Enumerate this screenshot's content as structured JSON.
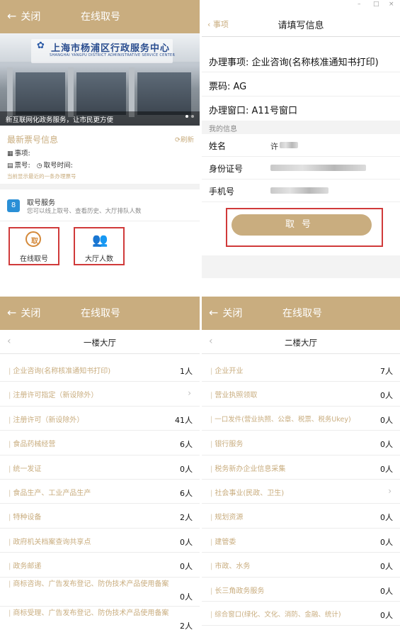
{
  "top_bar": {
    "close_label": "关闭",
    "title": "在线取号"
  },
  "panel1": {
    "banner": {
      "sign_cn": "上海市杨浦区行政服务中心",
      "sign_en": "SHANGHAI YANGPU DISTRICT ADMINISTRATIVE SERVICE CENTER",
      "caption": "新互联网化政务服务，让市民更方便"
    },
    "ticket": {
      "heading": "最新票号信息",
      "refresh": "刷新",
      "item_label": "事项:",
      "number_label": "票号:",
      "time_label": "取号时间:",
      "note": "当前显示最近的一条办理票号"
    },
    "service": {
      "title": "取号服务",
      "desc": "您可以线上取号、查看历史、大厅排队人数"
    },
    "tiles": [
      {
        "label": "在线取号",
        "icon_text": "取"
      },
      {
        "label": "大厅人数"
      }
    ]
  },
  "panel2": {
    "back_label": "事项",
    "title": "请填写信息",
    "matter": "办理事项: 企业咨询(名称核准通知书打印)",
    "ticket": "票码: AG",
    "window": "办理窗口: A11号窗口",
    "section": "我的信息",
    "fields": [
      {
        "label": "姓名",
        "value": "许"
      },
      {
        "label": "身份证号",
        "value": ""
      },
      {
        "label": "手机号",
        "value": ""
      }
    ],
    "submit_label": "取号"
  },
  "panel3": {
    "subtitle": "一楼大厅",
    "items": [
      {
        "name": "企业咨询(名称核准通知书打印)",
        "count": "1人"
      },
      {
        "name": "注册许可指定（新设除外）",
        "count": ""
      },
      {
        "name": "注册许可（新设除外）",
        "count": "41人"
      },
      {
        "name": "食品药械经营",
        "count": "6人"
      },
      {
        "name": "统一发证",
        "count": "0人"
      },
      {
        "name": "食品生产、工业产品生产",
        "count": "6人"
      },
      {
        "name": "特种设备",
        "count": "2人"
      },
      {
        "name": "政府机关档案查询共享点",
        "count": "0人"
      },
      {
        "name": "政务邮递",
        "count": "0人"
      },
      {
        "name": "商标咨询、广告发布登记、防伪技术产品使用备案",
        "count": "0人"
      },
      {
        "name": "商标受理、广告发布登记、防伪技术产品使用备案",
        "count": "2人"
      }
    ]
  },
  "panel4": {
    "subtitle": "二楼大厅",
    "items": [
      {
        "name": "企业开业",
        "count": "7人"
      },
      {
        "name": "营业执照领取",
        "count": "0人"
      },
      {
        "name": "一口发件(营业执照、公章、税票、税务Ukey)",
        "count": "0人"
      },
      {
        "name": "银行服务",
        "count": "0人"
      },
      {
        "name": "税务新办企业信息采集",
        "count": "0人"
      },
      {
        "name": "社会事业(民政、卫生)",
        "count": ""
      },
      {
        "name": "规划资源",
        "count": "0人"
      },
      {
        "name": "建管委",
        "count": "0人"
      },
      {
        "name": "市政、水务",
        "count": "0人"
      },
      {
        "name": "长三角政务服务",
        "count": "0人"
      },
      {
        "name": "综合窗口(绿化、文化、消防、金融、统计)",
        "count": "0人"
      }
    ]
  },
  "colors": {
    "accent": "#c9ad7f",
    "highlight": "#d03a3a"
  }
}
